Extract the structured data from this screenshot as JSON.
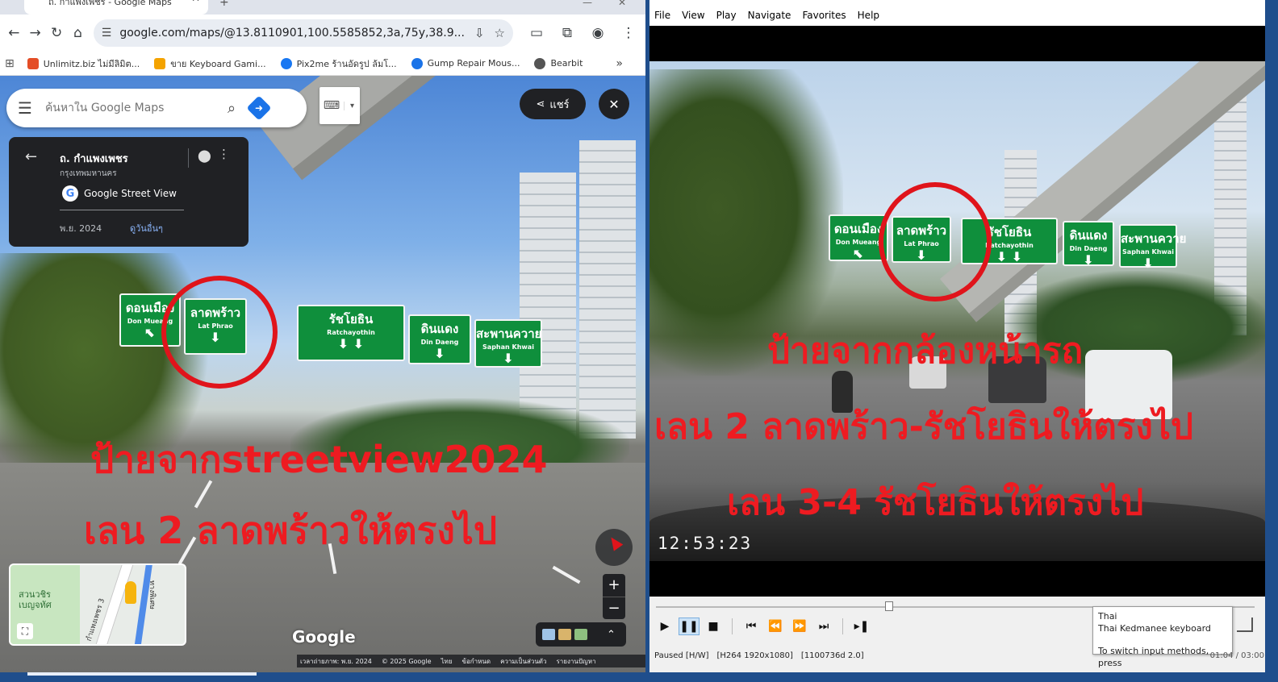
{
  "browser": {
    "tab_title": "ถ. กำแพงเพชร - Google Maps",
    "url": "google.com/maps/@13.8110901,100.5585852,3a,75y,38.9...",
    "bookmarks": [
      {
        "label": "Unlimitz.biz ไม่มีลิมิต...",
        "color": "#e44d26"
      },
      {
        "label": "ขาย Keyboard Gami...",
        "color": "#f4a300"
      },
      {
        "label": "Pix2me ร้านอัดรูป ล้มโ...",
        "color": "#1877f2"
      },
      {
        "label": "Gump Repair Mous...",
        "color": "#1a73e8"
      },
      {
        "label": "Bearbit",
        "color": "#555555"
      }
    ]
  },
  "maps": {
    "search_placeholder": "ค้นหาใน Google Maps",
    "share_label": "แชร์",
    "infocard": {
      "title": "ถ. กำแพงเพชร",
      "subtitle": "กรุงเทพมหานคร",
      "source": "Google Street View",
      "date": "พ.ย. 2024",
      "more_dates": "ดูวันอื่นๆ"
    },
    "signs": [
      {
        "th": "ดอนเมือง",
        "en": "Don Mueang"
      },
      {
        "th": "ลาดพร้าว",
        "en": "Lat Phrao"
      },
      {
        "th": "รัชโยธิน",
        "en": "Ratchayothin"
      },
      {
        "th": "ดินแดง",
        "en": "Din Daeng"
      },
      {
        "th": "สะพานควาย",
        "en": "Saphan Khwai"
      }
    ],
    "overlay_line1": "ป้ายจากstreetview2024",
    "overlay_line2": "เลน 2 ลาดพร้าวให้ตรงไป",
    "minimap": {
      "park_label": "สวนวชิรเบญจทัศ",
      "road_label": "ถ. กำแพงเพชร 3",
      "highway_label": "ทางพิเศษ"
    },
    "wordmark": "Google",
    "footer": [
      "เวลาถ่ายภาพ: พ.ย. 2024",
      "© 2025 Google",
      "ไทย",
      "ข้อกำหนด",
      "ความเป็นส่วนตัว",
      "รายงานปัญหา"
    ]
  },
  "player": {
    "menu": [
      "File",
      "View",
      "Play",
      "Navigate",
      "Favorites",
      "Help"
    ],
    "signs": [
      {
        "th": "ดอนเมือง",
        "en": "Don Mueang"
      },
      {
        "th": "ลาดพร้าว",
        "en": "Lat Phrao"
      },
      {
        "th": "รัชโยธิน",
        "en": "Ratchayothin"
      },
      {
        "th": "ดินแดง",
        "en": "Din Daeng"
      },
      {
        "th": "สะพานควาย",
        "en": "Saphan Khwai"
      }
    ],
    "overlay_line1": "ป้ายจากกล้องหน้ารถ",
    "overlay_line2": "เลน 2 ลาดพร้าว-รัชโยธินให้ตรงไป",
    "overlay_line3": "เลน 3-4 รัชโยธินให้ตรงไป",
    "timestamp": "12:53:23",
    "seek_fraction": 0.39,
    "status_state": "Paused [H/W]",
    "status_codec": "[H264 1920x1080]",
    "status_frames": "[1100736d 2.0]",
    "status_time": "01:04 / 03:00",
    "ime_tooltip": {
      "language": "Thai",
      "keyboard": "Thai Kedmanee keyboard",
      "hint": "To switch input methods, press"
    }
  },
  "colors": {
    "sign_green": "#0f8f3c",
    "overlay_red": "#ee1b21",
    "desktop_blue": "#1f4e8c"
  }
}
